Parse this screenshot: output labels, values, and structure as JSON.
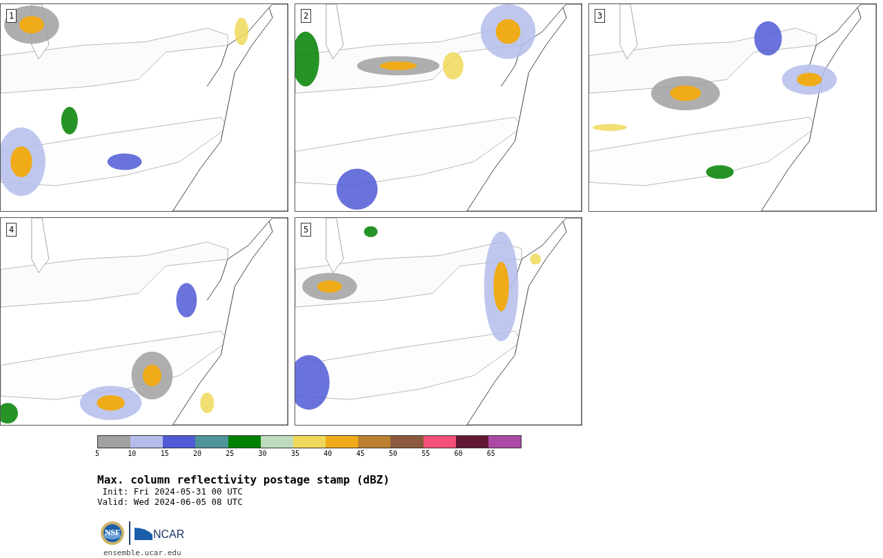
{
  "panels": [
    {
      "label": "1"
    },
    {
      "label": "2"
    },
    {
      "label": "3"
    },
    {
      "label": "4"
    },
    {
      "label": "5"
    }
  ],
  "colorbar": {
    "bins": [
      {
        "color": "#a0a0a0"
      },
      {
        "color": "#b4bdeb"
      },
      {
        "color": "#4f5bd5"
      },
      {
        "color": "#4e9499"
      },
      {
        "color": "#008000"
      },
      {
        "color": "#bddbbd"
      },
      {
        "color": "#efd95a"
      },
      {
        "color": "#efab18"
      },
      {
        "color": "#bb8030"
      },
      {
        "color": "#8a5a3e"
      },
      {
        "color": "#f45079"
      },
      {
        "color": "#621834"
      },
      {
        "color": "#ab4aa4"
      }
    ],
    "ticks": [
      "5",
      "10",
      "15",
      "20",
      "25",
      "30",
      "35",
      "40",
      "45",
      "50",
      "55",
      "60",
      "65"
    ]
  },
  "title": "Max. column reflectivity postage stamp (dBZ)",
  "init": " Init: Fri 2024-05-31 00 UTC",
  "valid": "Valid: Wed 2024-06-05 08 UTC",
  "logos": {
    "nsf": "NSF",
    "ncar": "NCAR"
  },
  "site": "ensemble.ucar.edu"
}
